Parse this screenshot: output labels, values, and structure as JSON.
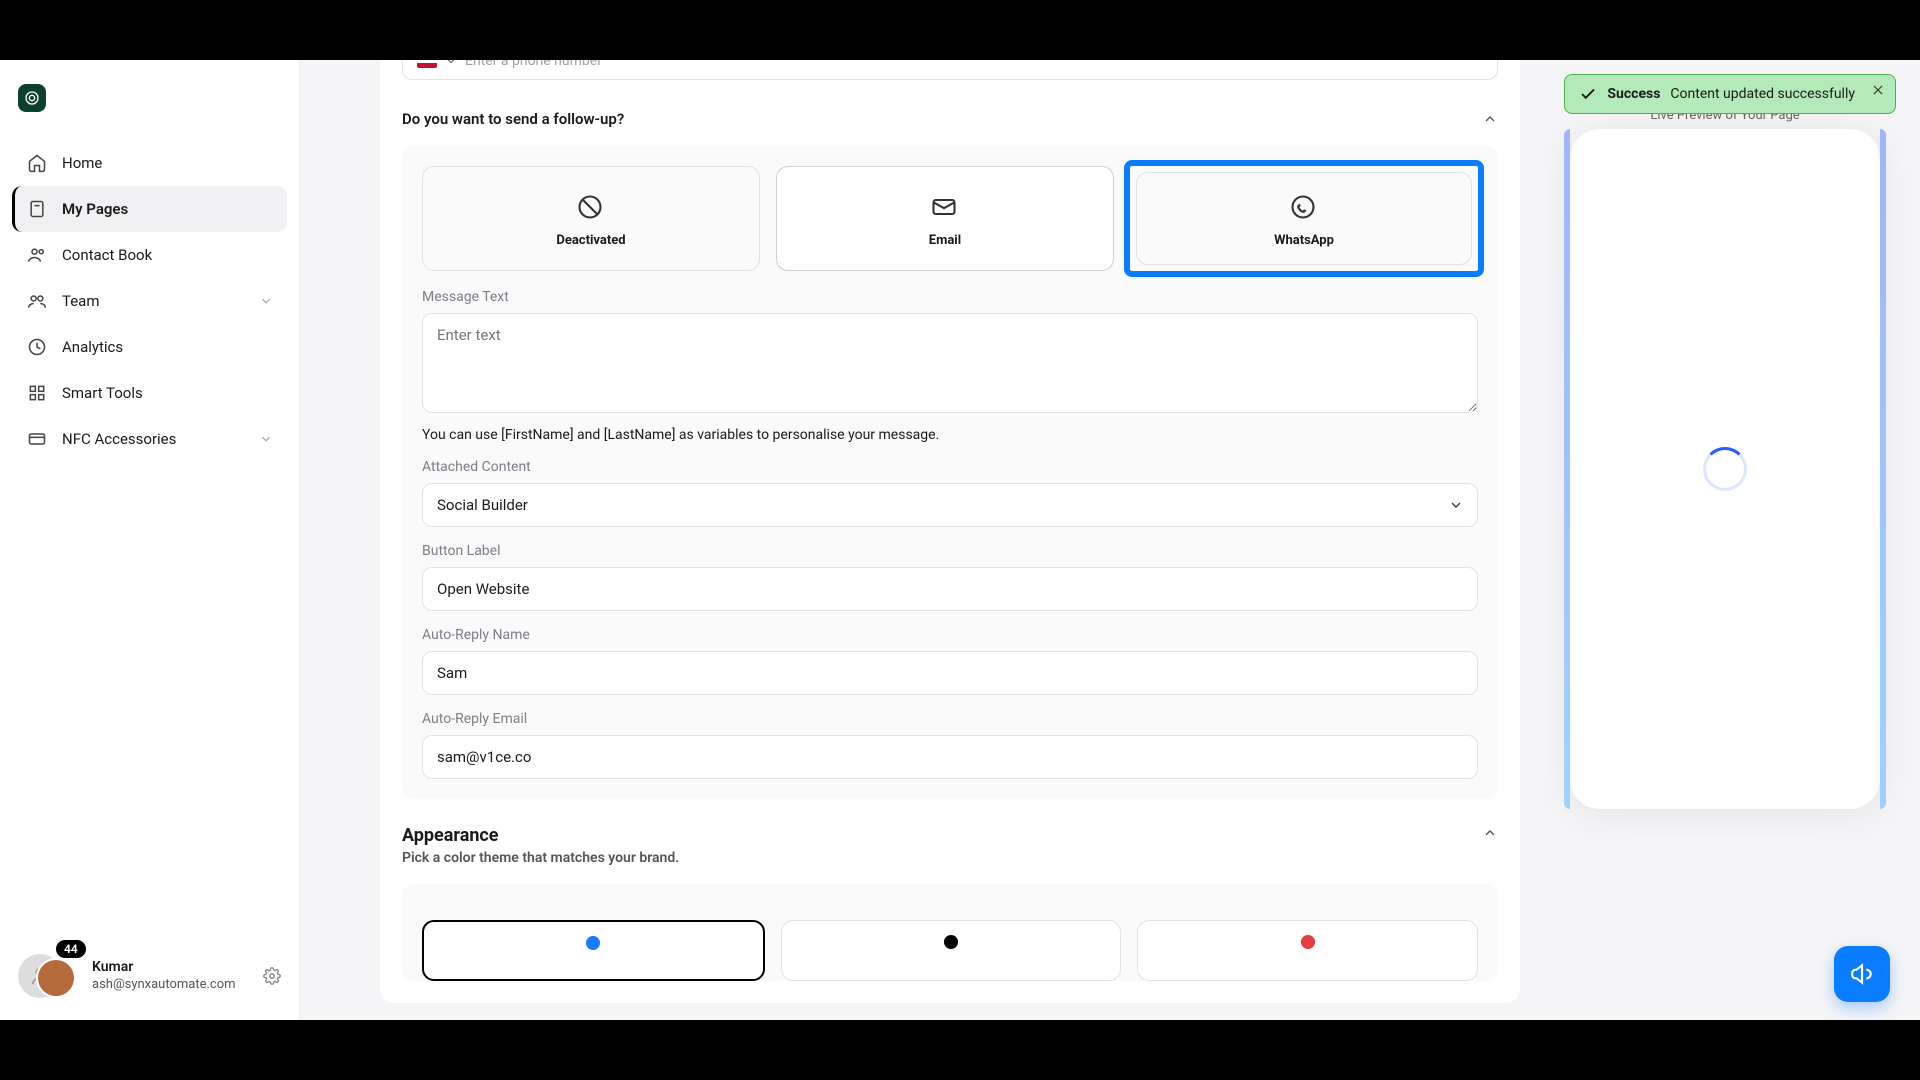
{
  "sidebar": {
    "items": [
      {
        "label": "Home"
      },
      {
        "label": "My Pages"
      },
      {
        "label": "Contact Book"
      },
      {
        "label": "Team"
      },
      {
        "label": "Analytics"
      },
      {
        "label": "Smart Tools"
      },
      {
        "label": "NFC Accessories"
      }
    ]
  },
  "phone": {
    "placeholder": "Enter a phone number"
  },
  "followup": {
    "heading": "Do you want to send a follow-up?",
    "options": {
      "deactivated": "Deactivated",
      "email": "Email",
      "whatsapp": "WhatsApp"
    },
    "message_label": "Message Text",
    "message_placeholder": "Enter text",
    "helper": "You can use [FirstName] and [LastName] as variables to personalise your message.",
    "attached_label": "Attached Content",
    "attached_value": "Social Builder",
    "button_label_label": "Button Label",
    "button_label_value": "Open Website",
    "autoreply_name_label": "Auto-Reply Name",
    "autoreply_name_value": "Sam",
    "autoreply_email_label": "Auto-Reply Email",
    "autoreply_email_value": "sam@v1ce.co"
  },
  "appearance": {
    "title": "Appearance",
    "subtitle": "Pick a color theme that matches your brand."
  },
  "preview": {
    "title": "Live Preview of Your Page"
  },
  "toast": {
    "title": "Success",
    "message": "Content updated successfully"
  },
  "user": {
    "name": "Kumar",
    "email": "ash@synxautomate.com",
    "badge": "44"
  }
}
